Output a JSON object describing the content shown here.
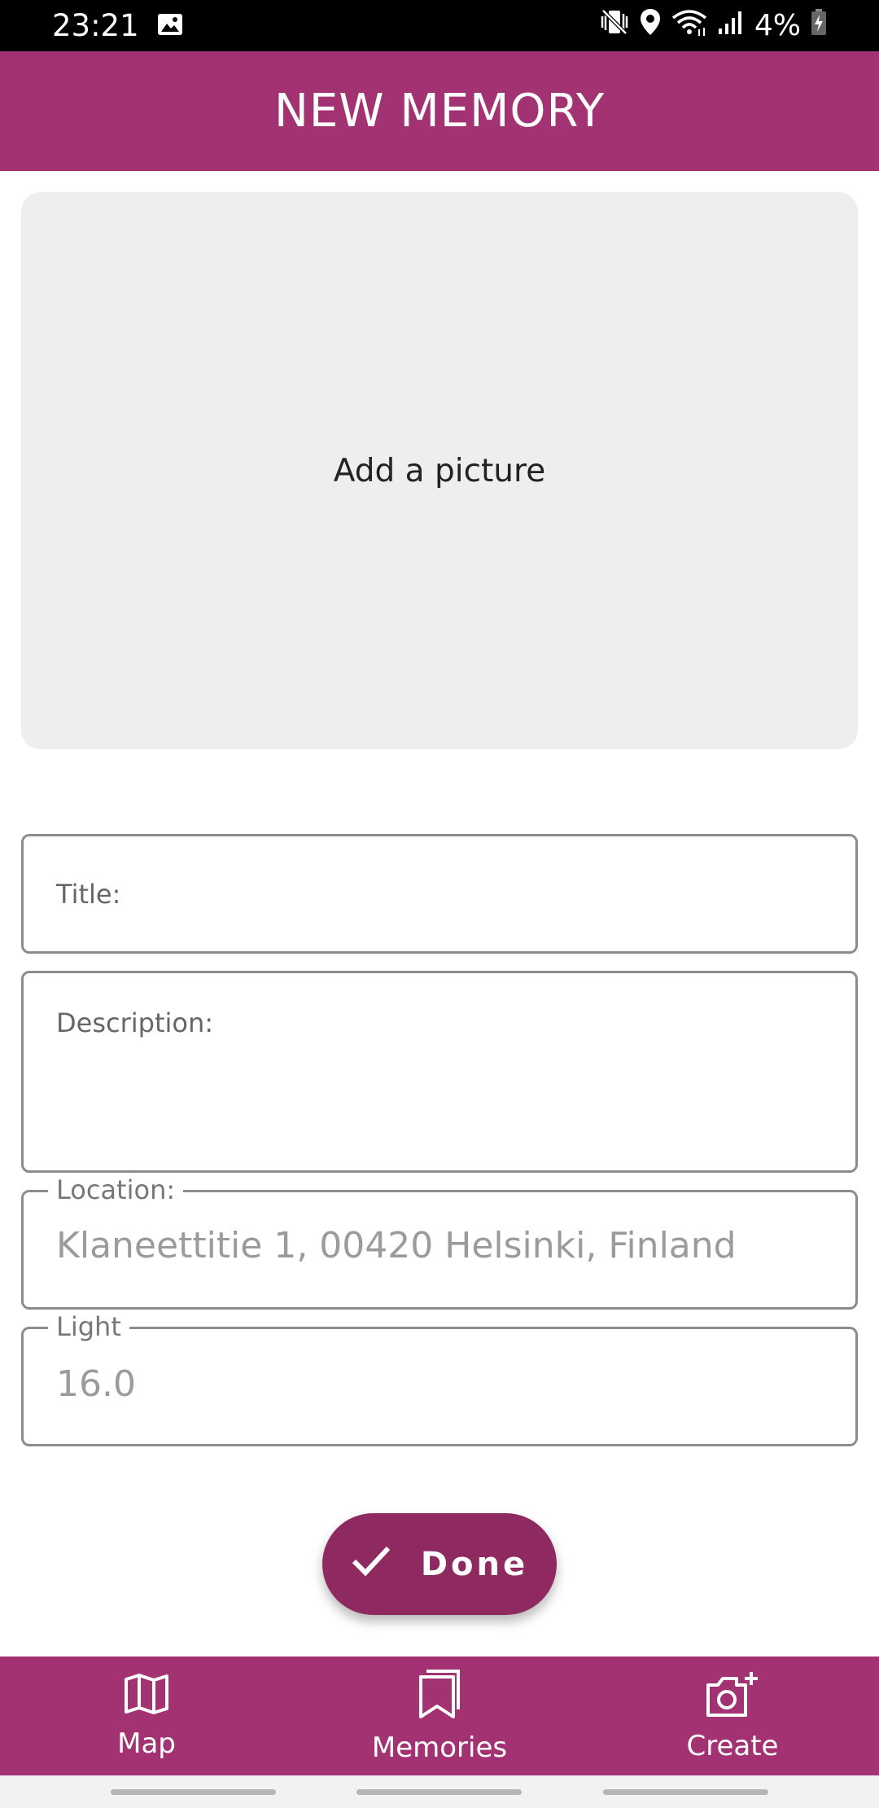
{
  "status_bar": {
    "time": "23:21",
    "battery": "4%",
    "icons": [
      "image-icon",
      "mute-vibrate-icon",
      "location-pin-icon",
      "wifi-icon",
      "signal-icon",
      "battery-charging-icon"
    ]
  },
  "app_bar": {
    "title": "NEW MEMORY"
  },
  "picture": {
    "label": "Add a picture"
  },
  "form": {
    "title_label": "Title:",
    "description_label": "Description:",
    "location_label": "Location:",
    "location_value": "Klaneettitie 1, 00420 Helsinki, Finland",
    "light_label": "Light",
    "light_value": "16.0"
  },
  "done_button": {
    "label": "Done",
    "icon": "check-icon"
  },
  "bottom_nav": {
    "items": [
      {
        "label": "Map",
        "icon": "map-icon"
      },
      {
        "label": "Memories",
        "icon": "bookmark-icon"
      },
      {
        "label": "Create",
        "icon": "camera-add-icon"
      }
    ]
  },
  "colors": {
    "primary": "#a23271",
    "button": "#8e2a60",
    "card": "#eeeeee"
  }
}
